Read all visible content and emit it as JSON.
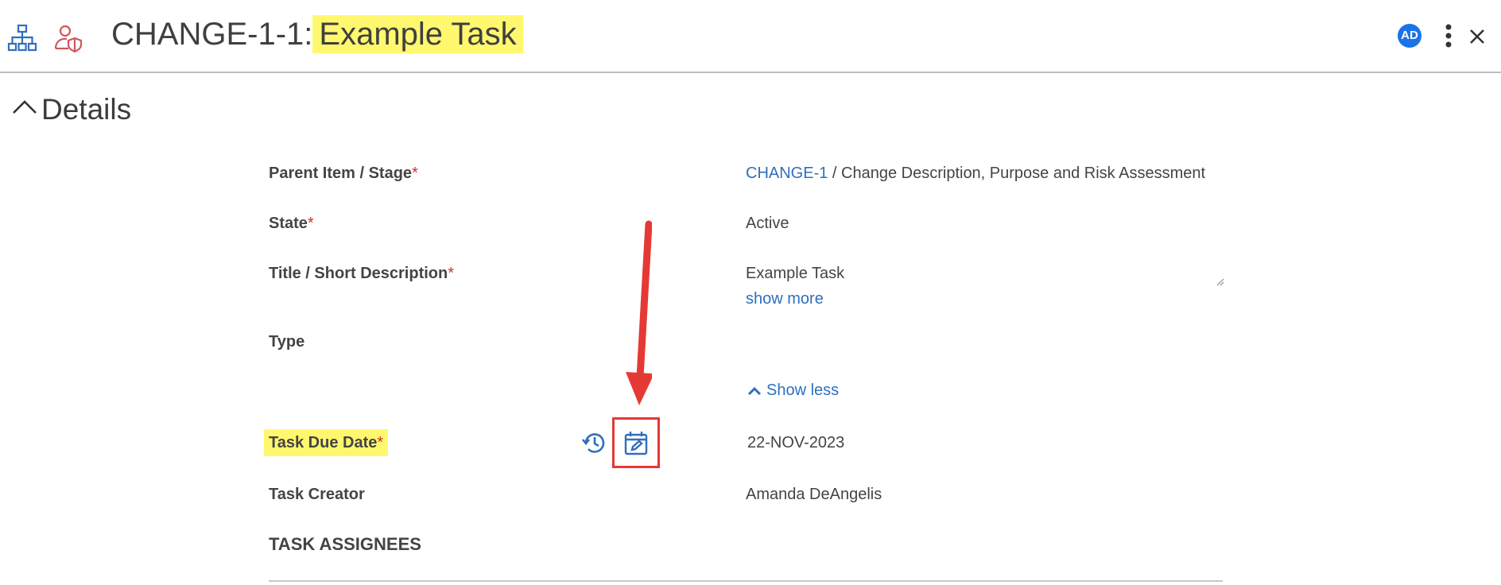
{
  "header": {
    "title_prefix": "CHANGE-1-1:",
    "title_highlight": "Example Task",
    "avatar_initials": "AD",
    "icons": [
      "hierarchy-icon",
      "user-shield-icon",
      "kebab-menu-icon",
      "close-icon"
    ]
  },
  "section": {
    "title": "Details",
    "toggle_icon": "chevron-up-icon"
  },
  "fields": {
    "parent": {
      "label": "Parent Item / Stage",
      "required": "*",
      "link": "CHANGE-1",
      "text": " / Change Description, Purpose and Risk Assessment"
    },
    "state": {
      "label": "State",
      "required": "*",
      "value": "Active"
    },
    "title": {
      "label": "Title / Short Description",
      "required": "*",
      "value": "Example Task",
      "show_more": "show more"
    },
    "type": {
      "label": "Type",
      "value": "",
      "show_less": "Show less"
    },
    "due": {
      "label": "Task Due Date",
      "required": "*",
      "value": "22-NOV-2023"
    },
    "creator": {
      "label": "Task Creator",
      "value": "Amanda DeAngelis"
    }
  },
  "assignees": {
    "heading": "TASK ASSIGNEES"
  },
  "colors": {
    "accent": "#2f6fbd",
    "highlight": "#fff86e",
    "annotation": "#e53935",
    "avatar": "#1a73e8"
  }
}
